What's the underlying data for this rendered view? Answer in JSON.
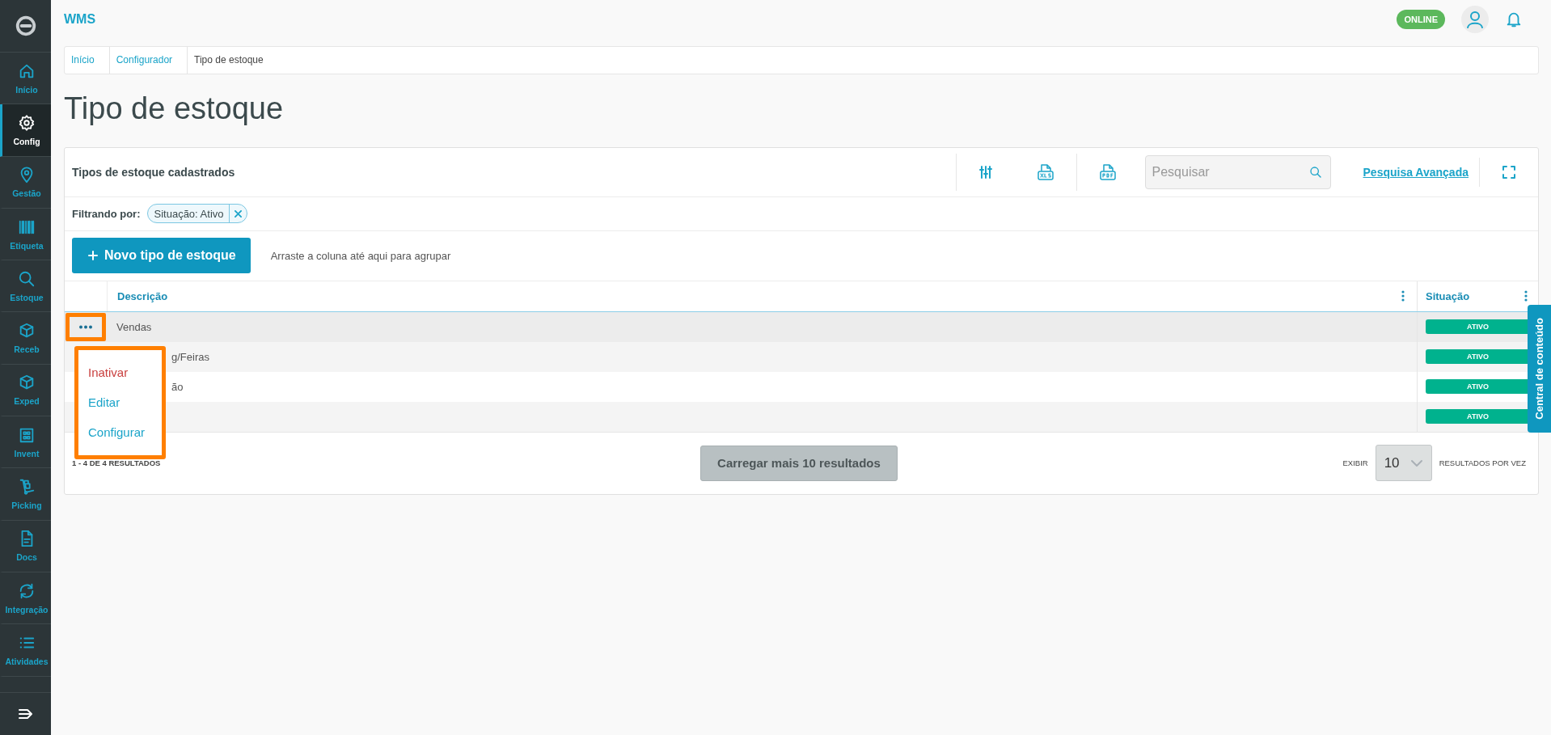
{
  "app": {
    "title": "WMS",
    "status": "ONLINE"
  },
  "sidebar": {
    "items": [
      {
        "label": "Início",
        "selected": false
      },
      {
        "label": "Config",
        "selected": true
      },
      {
        "label": "Gestão",
        "selected": false
      },
      {
        "label": "Etiqueta",
        "selected": false
      },
      {
        "label": "Estoque",
        "selected": false
      },
      {
        "label": "Receb",
        "selected": false
      },
      {
        "label": "Exped",
        "selected": false
      },
      {
        "label": "Invent",
        "selected": false
      },
      {
        "label": "Picking",
        "selected": false
      },
      {
        "label": "Docs",
        "selected": false
      },
      {
        "label": "Integração",
        "selected": false
      },
      {
        "label": "Atividades",
        "selected": false
      }
    ]
  },
  "breadcrumb": [
    {
      "label": "Início",
      "current": false
    },
    {
      "label": "Configurador",
      "current": false
    },
    {
      "label": "Tipo de estoque",
      "current": true
    }
  ],
  "page_title": "Tipo de estoque",
  "panel": {
    "title": "Tipos de estoque cadastrados",
    "search": {
      "placeholder": "Pesquisar"
    },
    "advanced_search": "Pesquisa Avançada",
    "filter": {
      "label": "Filtrando por:",
      "chips": [
        {
          "label": "Situação: Ativo"
        }
      ]
    },
    "new_button": "Novo tipo de estoque",
    "group_hint": "Arraste a coluna até aqui para agrupar",
    "table": {
      "columns": [
        "Descrição",
        "Situação"
      ],
      "rows": [
        {
          "description": "Vendas",
          "status": "ATIVO",
          "selected": true,
          "menu_open": true
        },
        {
          "description": "g/Feiras",
          "status": "ATIVO",
          "selected": false,
          "menu_open": false
        },
        {
          "description": "ão",
          "status": "ATIVO",
          "selected": false,
          "menu_open": false
        },
        {
          "status": "ATIVO",
          "selected": false,
          "menu_open": false
        }
      ]
    },
    "row_menu": [
      {
        "label": "Inativar",
        "kind": "danger"
      },
      {
        "label": "Editar",
        "kind": "normal"
      },
      {
        "label": "Configurar",
        "kind": "normal"
      }
    ],
    "result_count": "1 - 4 DE 4 RESULTADOS",
    "load_more": "Carregar mais 10 resultados",
    "page_size": {
      "label": "EXIBIR",
      "value": "10",
      "suffix": "RESULTADOS POR VEZ"
    }
  },
  "side_tab": "Central de conteúdo"
}
